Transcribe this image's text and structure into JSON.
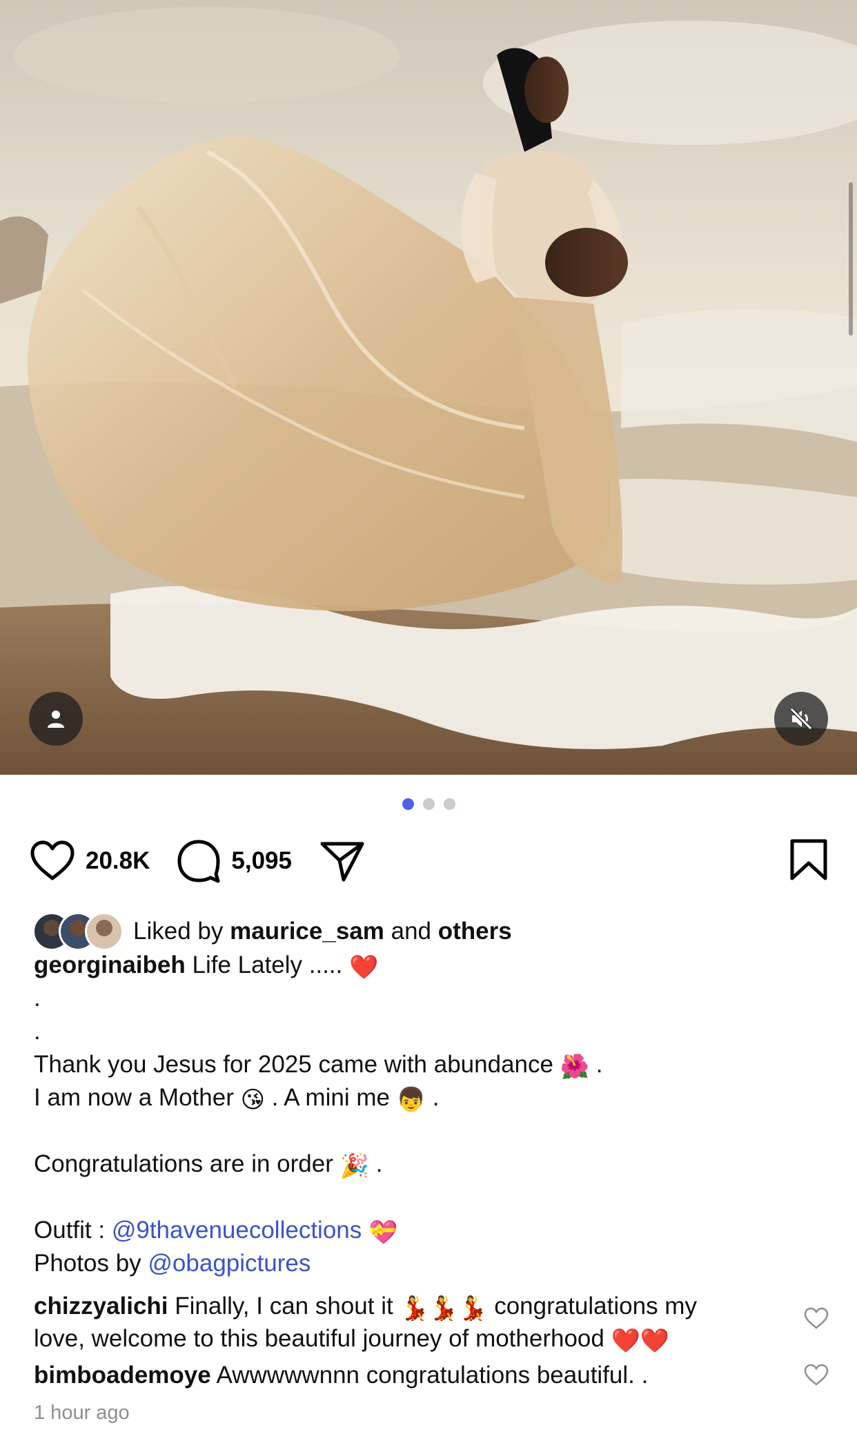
{
  "post": {
    "like_count": "20.8K",
    "comment_count": "5,095",
    "liked_by_prefix": "Liked by",
    "liked_by_user": "maurice_sam",
    "liked_by_and": "and",
    "liked_by_others": "others",
    "carousel": {
      "total": 3,
      "active": 1
    }
  },
  "caption": {
    "username": "georginaibeh",
    "first_line": "Life Lately .....",
    "first_line_emoji": "❤️",
    "dot1": ".",
    "dot2": ".",
    "line3": "Thank you Jesus for 2025 came with abundance",
    "line3_emoji": "🌺",
    "line3_end": ".",
    "line4": "I am now a Mother",
    "line4_emoji1": "😘",
    "line4_mid": ". A mini me",
    "line4_emoji2": "👦",
    "line4_end": ".",
    "line6": "Congratulations are in order",
    "line6_emoji": "🎉",
    "line6_end": ".",
    "outfit_label": "Outfit :",
    "outfit_handle": "@9thavenuecollections",
    "outfit_emoji": "💝",
    "photos_label": "Photos by",
    "photos_handle": "@obagpictures"
  },
  "comments": [
    {
      "username": "chizzyalichi",
      "text_a": "Finally, I can shout it",
      "emoji_a": "💃💃💃",
      "text_b": "congratulations my",
      "text_c": "love, welcome to this beautiful journey of motherhood",
      "emoji_c": "❤️❤️"
    },
    {
      "username": "bimboademoye",
      "text_a": "Awwwwwnnn congratulations beautiful. ."
    }
  ],
  "timestamp": "1 hour ago",
  "icons": [
    "user-tag-icon",
    "mute-icon",
    "heart-icon",
    "comment-icon",
    "share-icon",
    "bookmark-icon"
  ],
  "colors": {
    "link": "#3b53c6",
    "carousel_active": "#4a63e7",
    "muted_text": "#8e8e8e"
  }
}
